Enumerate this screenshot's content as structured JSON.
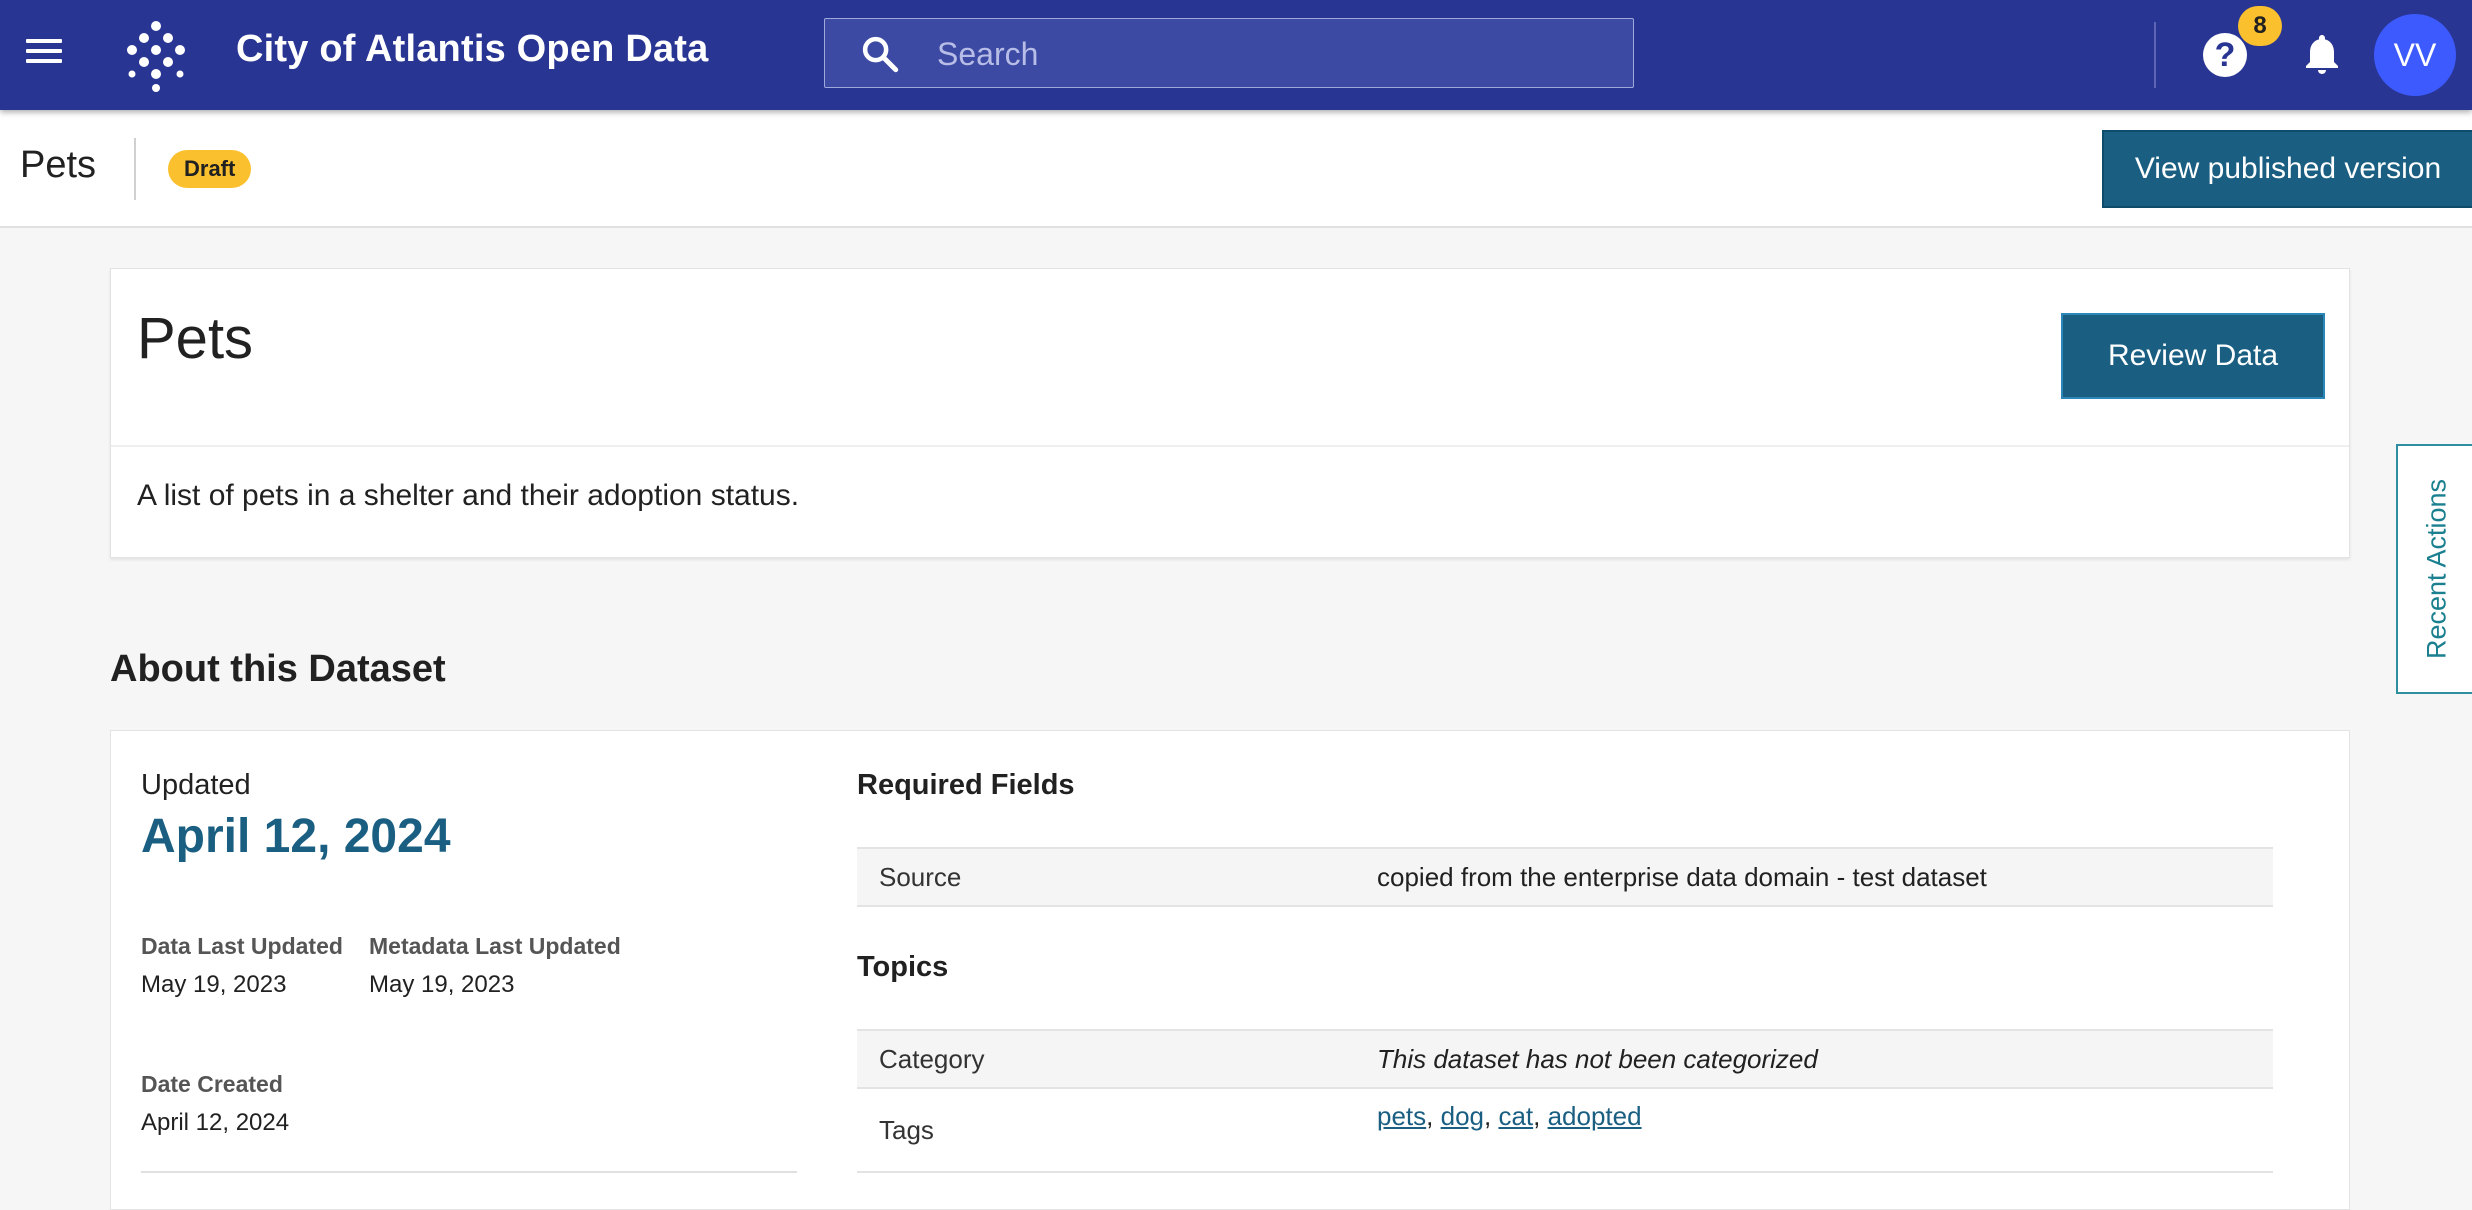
{
  "nav": {
    "title": "City of Atlantis Open Data",
    "search_placeholder": "Search",
    "notification_count": "8",
    "user_initials": "VV"
  },
  "subheader": {
    "title": "Pets",
    "status": "Draft",
    "view_published_label": "View published version"
  },
  "dataset": {
    "title": "Pets",
    "review_label": "Review Data",
    "description": "A list of pets in a shelter and their adoption status."
  },
  "recent_actions_label": "Recent Actions",
  "about": {
    "heading": "About this Dataset",
    "updated_label": "Updated",
    "updated_date": "April 12, 2024",
    "data_last_updated_label": "Data Last Updated",
    "data_last_updated": "May 19, 2023",
    "metadata_last_updated_label": "Metadata Last Updated",
    "metadata_last_updated": "May 19, 2023",
    "date_created_label": "Date Created",
    "date_created": "April 12, 2024",
    "required_fields_title": "Required Fields",
    "source_label": "Source",
    "source_value": "copied from the enterprise data domain - test dataset",
    "topics_title": "Topics",
    "category_label": "Category",
    "category_value": "This dataset has not been categorized",
    "tags_label": "Tags",
    "tags": [
      "pets",
      "dog",
      "cat",
      "adopted"
    ]
  },
  "colors": {
    "nav_bg": "#283593",
    "primary_button": "#1a5f82",
    "draft_badge": "#fbc02d",
    "avatar": "#3d5afe",
    "recent_tab": "#2e8fa0"
  }
}
